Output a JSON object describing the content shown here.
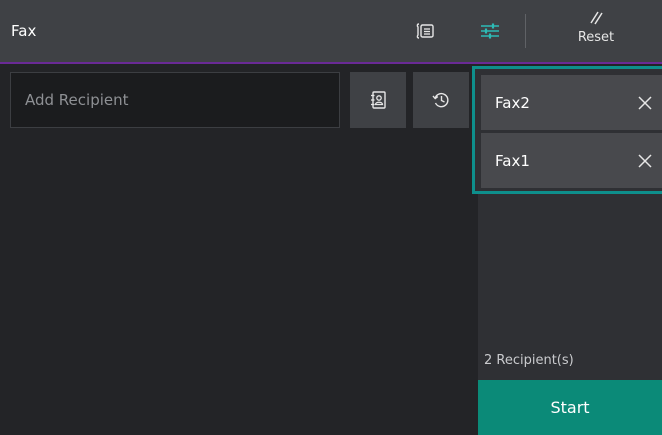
{
  "header": {
    "title": "Fax",
    "reset_label": "Reset",
    "icons": [
      "fax-machine-icon",
      "adjust-sliders-icon",
      "reset-slash-icon"
    ]
  },
  "recipient": {
    "placeholder": "Add Recipient",
    "address_book_icon": "address-book-icon",
    "history_icon": "history-icon"
  },
  "recipients": {
    "items": [
      {
        "label": "Fax2"
      },
      {
        "label": "Fax1"
      }
    ],
    "count_text": "2 Recipient(s)"
  },
  "start_label": "Start",
  "colors": {
    "header_bg": "#3f4145",
    "accent_purple": "#6a2a96",
    "selection_border": "#0e8f8c",
    "start_button": "#0b8a78",
    "adjust_icon": "#2dbbb6"
  }
}
